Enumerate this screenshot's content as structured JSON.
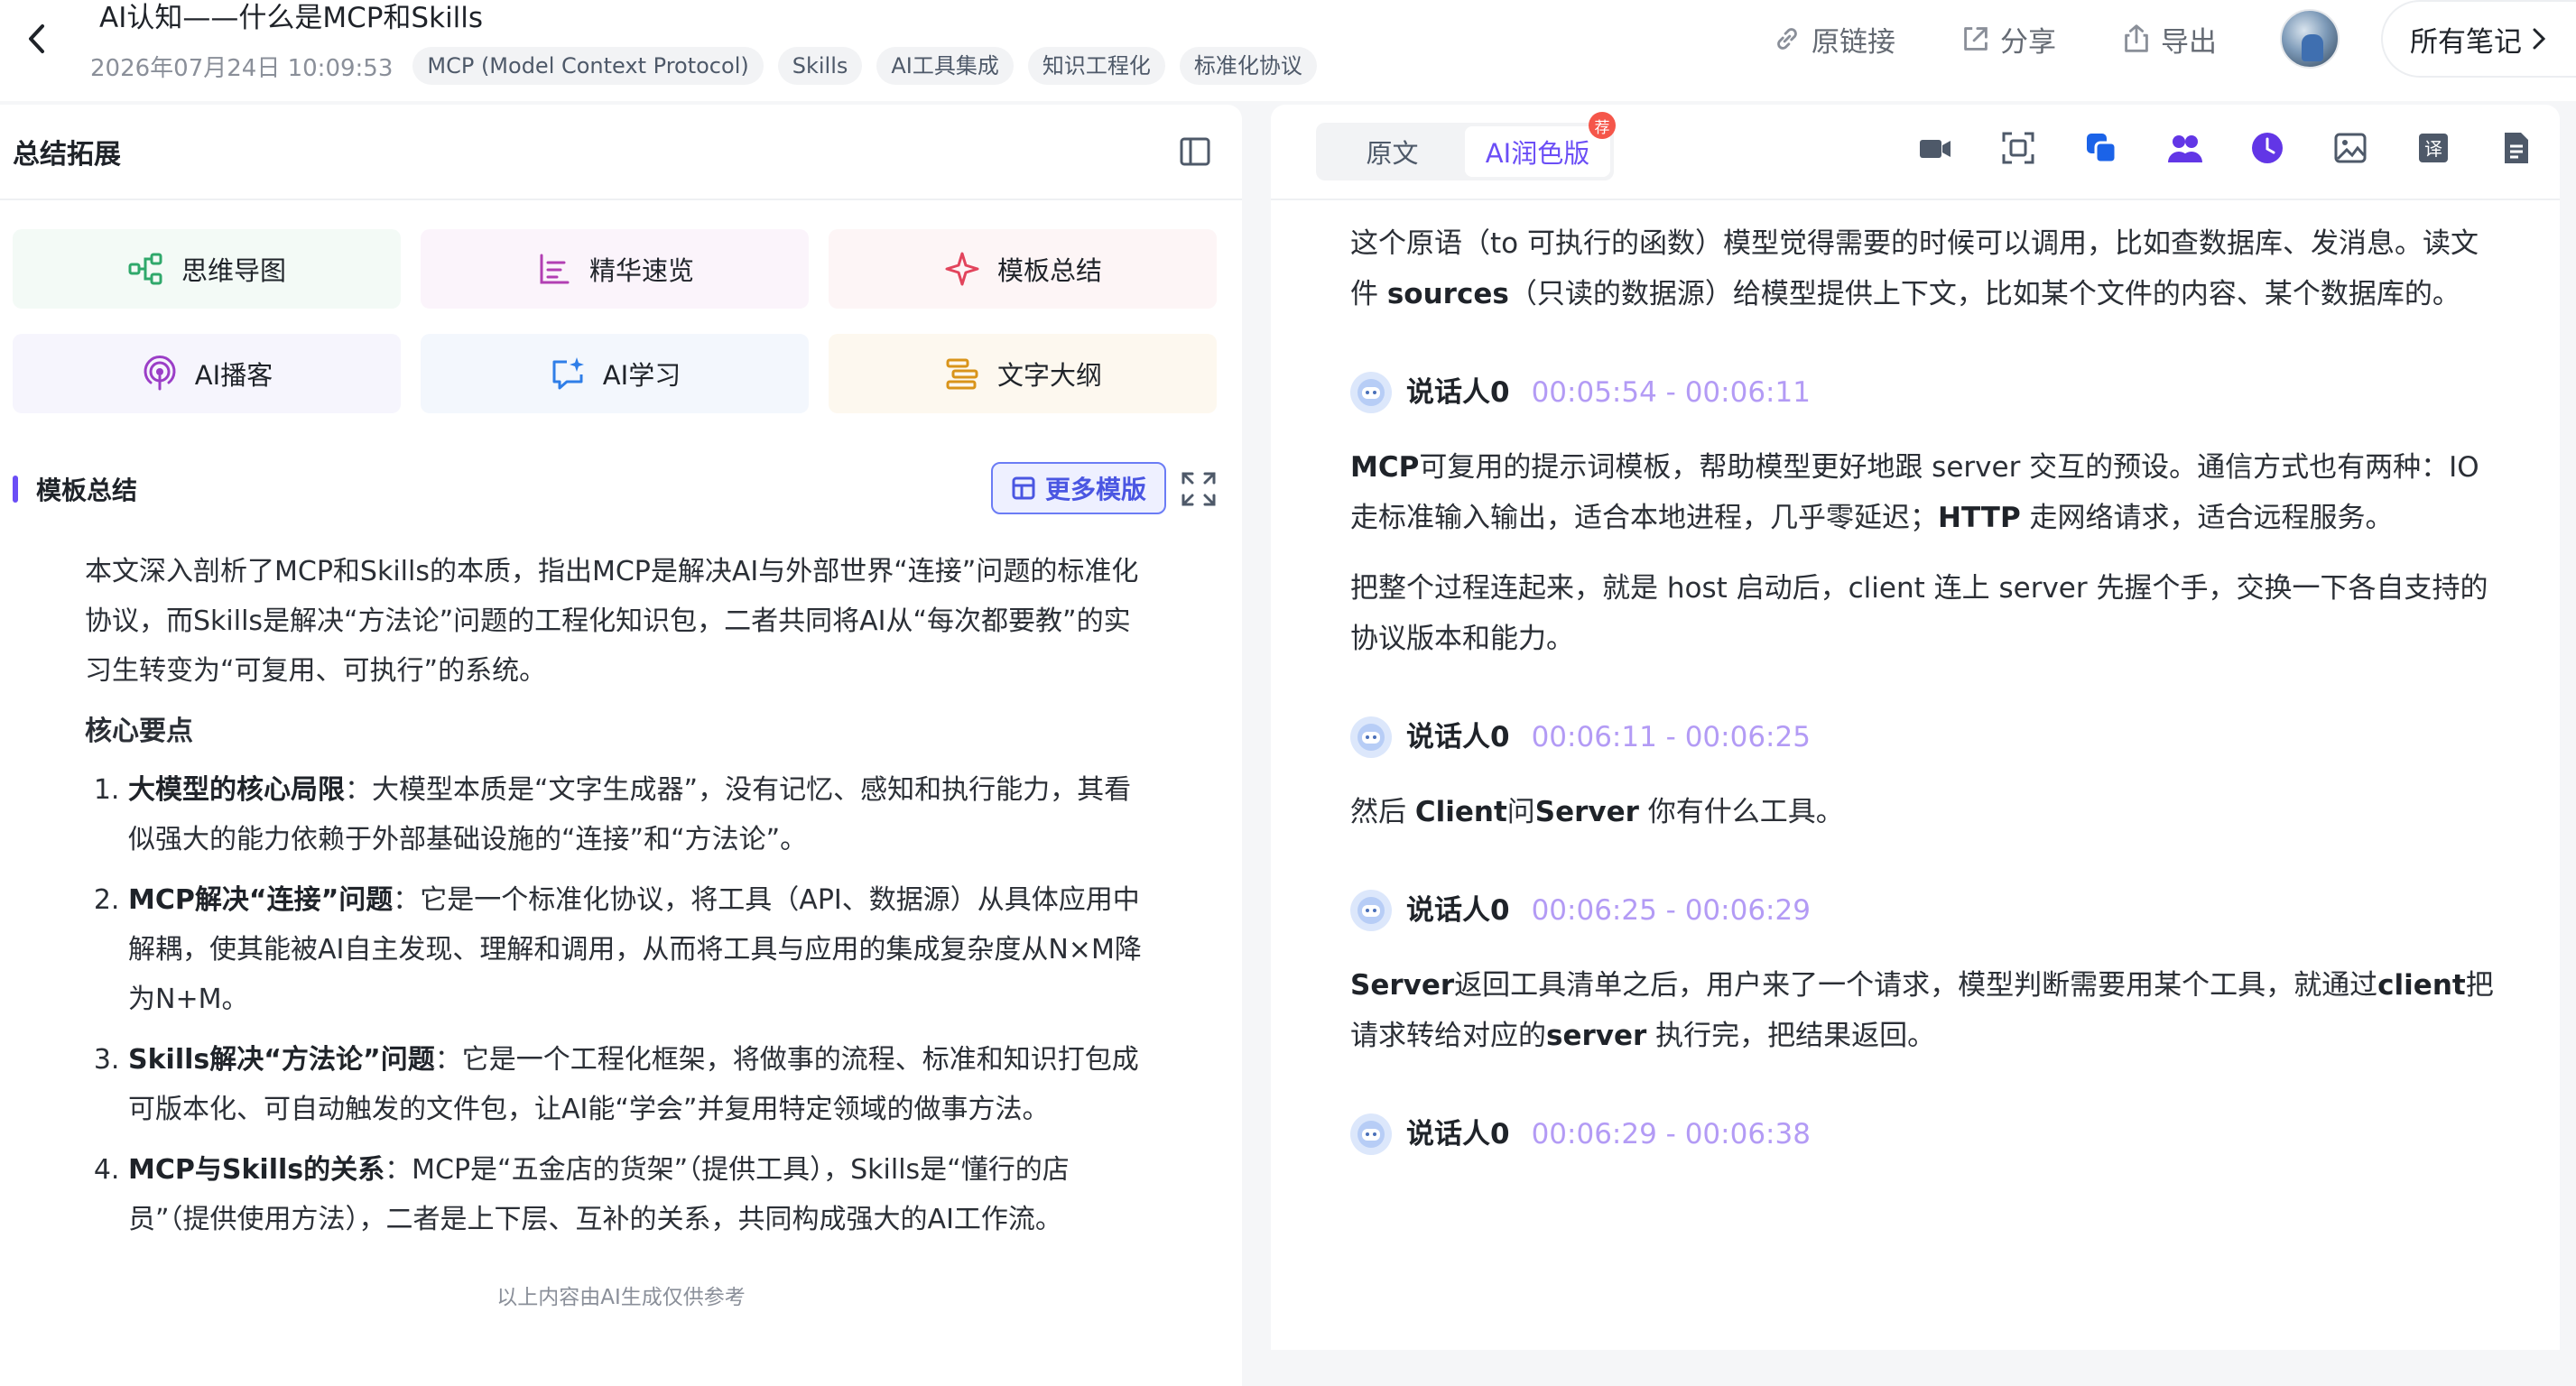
{
  "header": {
    "title": "AI认知——什么是MCP和Skills",
    "timestamp": "2026年07月24日 10:09:53",
    "tags": [
      "MCP (Model Context Protocol)",
      "Skills",
      "AI工具集成",
      "知识工程化",
      "标准化协议"
    ],
    "actions": {
      "link": "原链接",
      "share": "分享",
      "export": "导出",
      "all_notes": "所有笔记"
    }
  },
  "left": {
    "panel_title": "总结拓展",
    "tools": [
      "思维导图",
      "精华速览",
      "模板总结",
      "AI播客",
      "AI学习",
      "文字大纲"
    ],
    "section_title": "模板总结",
    "more_templates": "更多模版",
    "summary": {
      "intro": "本文深入剖析了MCP和Skills的本质，指出MCP是解决AI与外部世界“连接”问题的标准化协议，而Skills是解决“方法论”问题的工程化知识包，二者共同将AI从“每次都要教”的实习生转变为“可复用、可执行”的系统。",
      "heading": "核心要点",
      "points": [
        {
          "title": "大模型的核心局限",
          "text": "：大模型本质是“文字生成器”，没有记忆、感知和执行能力，其看似强大的能力依赖于外部基础设施的“连接”和“方法论”。"
        },
        {
          "title": "MCP解决“连接”问题",
          "text": "：它是一个标准化协议，将工具（API、数据源）从具体应用中解耦，使其能被AI自主发现、理解和调用，从而将工具与应用的集成复杂度从N×M降为N+M。"
        },
        {
          "title": "Skills解决“方法论”问题",
          "text": "：它是一个工程化框架，将做事的流程、标准和知识打包成可版本化、可自动触发的文件包，让AI能“学会”并复用特定领域的做事方法。"
        },
        {
          "title": "MCP与Skills的关系",
          "text": "：MCP是“五金店的货架”（提供工具），Skills是“懂行的店员”（提供使用方法），二者是上下层、互补的关系，共同构成强大的AI工作流。"
        }
      ]
    },
    "disclaimer": "以上内容由AI生成仅供参考"
  },
  "right": {
    "tabs": [
      "原文",
      "AI润色版"
    ],
    "badge": "荐",
    "transcript": {
      "first_paragraph": {
        "text_a": "这个原语（to 可执行的函数）模型觉得需要的时候可以调用，比如查数据库、发消息。读文件 ",
        "bold_a": "sources",
        "text_b": "（只读的数据源）给模型提供上下文，比如某个文件的内容、某个数据库的。"
      },
      "blocks": [
        {
          "speaker": "说话人0",
          "time": "00:05:54 - 00:06:11",
          "p1_bold1": "MCP",
          "p1_text1": "可复用的提示词模板，帮助模型更好地跟 server 交互的预设。通信方式也有两种：IO 走标准输入输出，适合本地进程，几乎零延迟；",
          "p1_bold2": "HTTP",
          "p1_text2": " 走网络请求，适合远程服务。",
          "p2": "把整个过程连起来，就是 host 启动后，client 连上 server 先握个手，交换一下各自支持的协议版本和能力。"
        },
        {
          "speaker": "说话人0",
          "time": "00:06:11 - 00:06:25",
          "p_text1": "然后 ",
          "p_bold1": "Client",
          "p_text2": "问",
          "p_bold2": "Server",
          "p_text3": " 你有什么工具。"
        },
        {
          "speaker": "说话人0",
          "time": "00:06:25 - 00:06:29",
          "p_bold1": "Server",
          "p_text1": "返回工具清单之后，用户来了一个请求，模型判断需要用某个工具，就通过",
          "p_bold2": "client",
          "p_text2": "把请求转给对应的",
          "p_bold3": "server",
          "p_text3": " 执行完，把结果返回。"
        },
        {
          "speaker": "说话人0",
          "time": "00:06:29 - 00:06:38"
        }
      ]
    }
  }
}
